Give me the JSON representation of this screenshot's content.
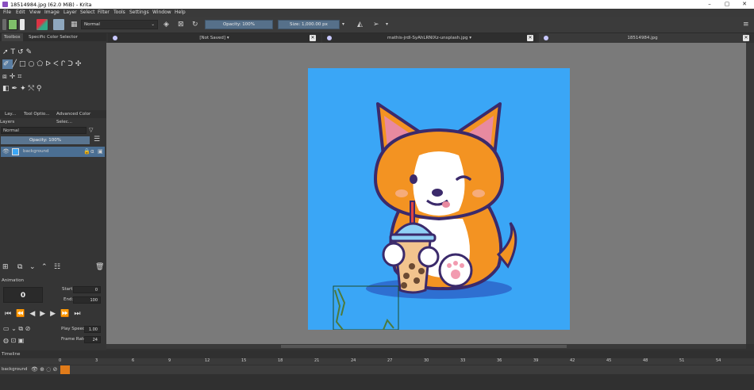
{
  "window": {
    "title": "18514984.jpg (62.0 MiB)  - Krita",
    "controls": [
      "–",
      "▢",
      "✕"
    ]
  },
  "menu": [
    "File",
    "Edit",
    "View",
    "Image",
    "Layer",
    "Select",
    "Filter",
    "Tools",
    "Settings",
    "Window",
    "Help"
  ],
  "toolbar": {
    "blend_mode": "Normal",
    "opacity": "Opacity: 100%",
    "size": "Size: 1,000.00 px"
  },
  "left_panel": {
    "dock_tabs": [
      "Toolbox",
      "Specific Color Selector"
    ],
    "lower_tabs": [
      "Lay...",
      "Tool Optio...",
      "Advanced Color Selec..."
    ],
    "layers_title": "Layers",
    "layer_blend": "Normal",
    "layer_opacity": "Opacity:  100%",
    "layers": [
      {
        "name": "background"
      }
    ],
    "animation": {
      "title": "Animation",
      "current_frame": "0",
      "start_label": "Start:",
      "start_value": "0",
      "end_label": "End:",
      "end_value": "100",
      "play_speed_label": "Play Speed:",
      "play_speed_value": "1.00",
      "frame_rate_label": "Frame Rate:",
      "frame_rate_value": "24"
    }
  },
  "documents": [
    {
      "title": "[Not Saved]"
    },
    {
      "title": "mathis-jrdl-SyAhLRNIXz-unsplash.jpg"
    },
    {
      "title": "18514984.jpg"
    }
  ],
  "timeline": {
    "title": "Timeline",
    "layer_name": "background",
    "frame_numbers": [
      "0",
      "3",
      "6",
      "9",
      "12",
      "15",
      "18",
      "21",
      "24",
      "27",
      "30",
      "33",
      "36",
      "39",
      "42",
      "45",
      "48",
      "51",
      "54"
    ]
  },
  "colors": {
    "canvas_bg": "#3aa6f6",
    "accent": "#5a7ea3",
    "active_frame": "#e07b1a"
  }
}
